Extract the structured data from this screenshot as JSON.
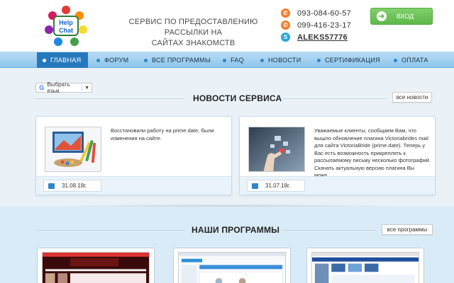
{
  "header": {
    "logo_text": "Help Chat",
    "tagline_line1": "СЕРВИС ПО ПРЕДОСТАВЛЕНИЮ РАССЫЛКИ НА",
    "tagline_line2": "САЙТАХ ЗНАКОМСТВ",
    "phone1": "093-084-60-57",
    "phone2": "099-416-23-17",
    "skype": "ALEKS57776",
    "login_label": "ВХОД"
  },
  "nav": {
    "items": [
      {
        "label": "ГЛАВНАЯ"
      },
      {
        "label": "ФОРУМ"
      },
      {
        "label": "ВСЕ ПРОГРАММЫ"
      },
      {
        "label": "FAQ"
      },
      {
        "label": "НОВОСТИ"
      },
      {
        "label": "СЕРТИФИКАЦИЯ"
      },
      {
        "label": "ОПЛАТА"
      }
    ]
  },
  "lang": {
    "label": "Выбрать язык"
  },
  "news": {
    "title": "НОВОСТИ СЕРВИСА",
    "more_label": "все новости",
    "items": [
      {
        "text": "Восстановили работу на prime.date, были изменения на сайте.",
        "date": "31.08.18г."
      },
      {
        "text": "Уважаемые клиенты, сообщаем Вам, что вышло обновление плагина Victoriabrides mail для сайта VictoriaBride (prime.date). Теперь у Вас есть возможность прикреплять к рассылаемому письму несколько фотографий. Скачать актуальную версию плагина Вы може...",
        "date": "31.07.18г."
      }
    ]
  },
  "programs": {
    "title": "НАШИ ПРОГРАММЫ",
    "more_label": "все программы"
  },
  "colors": {
    "nav_active": "#2779bd",
    "login_green": "#5fb84a",
    "phone_orange": "#f07d2c",
    "skype_blue": "#2aa7e0"
  }
}
